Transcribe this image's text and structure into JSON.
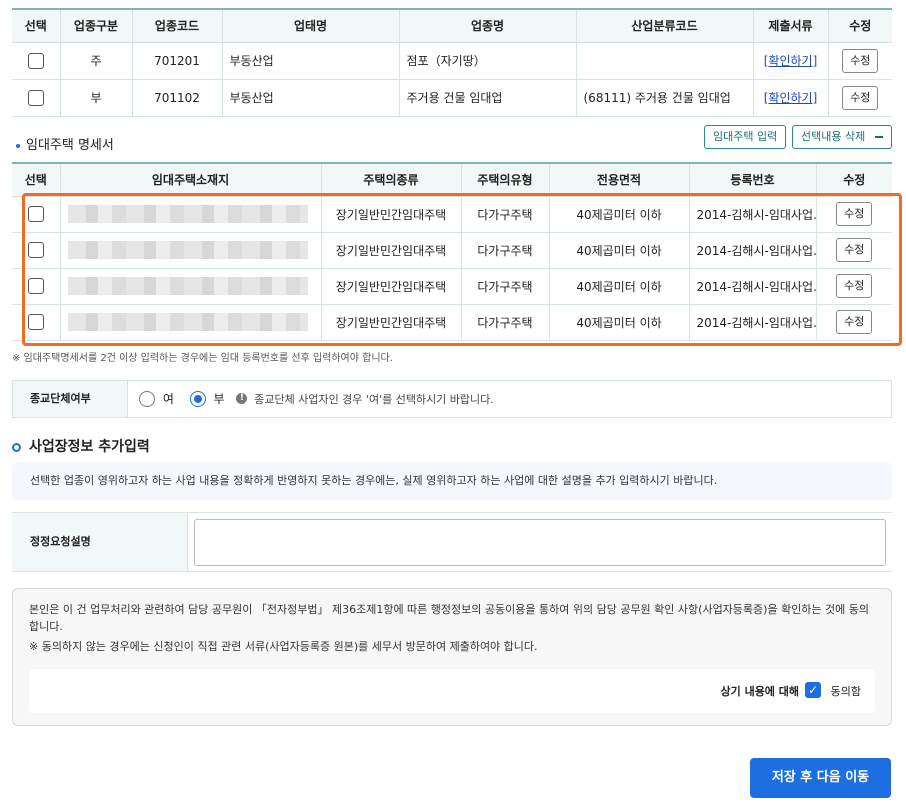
{
  "industry_table": {
    "headers": [
      "선택",
      "업종구분",
      "업종코드",
      "업태명",
      "업종명",
      "산업분류코드",
      "제출서류",
      "수정"
    ],
    "rows": [
      {
        "type": "주",
        "code": "701201",
        "business": "부동산업",
        "item": "점포（자기땅）",
        "class_code": "",
        "doc_link": "[확인하기]",
        "edit": "수정"
      },
      {
        "type": "부",
        "code": "701102",
        "business": "부동산업",
        "item": "주거용 건물 임대업",
        "class_code": "(68111) 주거용 건물 임대업",
        "doc_link": "[확인하기]",
        "edit": "수정"
      }
    ]
  },
  "rental_section": {
    "title": "임대주택 명세서",
    "input_button": "임대주택 입력",
    "delete_button": "선택내용 삭제",
    "delete_icon": "minus-icon"
  },
  "rental_table": {
    "headers": [
      "선택",
      "임대주택소재지",
      "주택의종류",
      "주택의유형",
      "전용면적",
      "등록번호",
      "수정"
    ],
    "rows": [
      {
        "kind": "장기일반민간임대주택",
        "housing_type": "다가구주택",
        "area": "40제곱미터 이하",
        "reg_no": "2014-김해시-임대사업…",
        "edit": "수정"
      },
      {
        "kind": "장기일반민간임대주택",
        "housing_type": "다가구주택",
        "area": "40제곱미터 이하",
        "reg_no": "2014-김해시-임대사업…",
        "edit": "수정"
      },
      {
        "kind": "장기일반민간임대주택",
        "housing_type": "다가구주택",
        "area": "40제곱미터 이하",
        "reg_no": "2014-김해시-임대사업…",
        "edit": "수정"
      },
      {
        "kind": "장기일반민간임대주택",
        "housing_type": "다가구주택",
        "area": "40제곱미터 이하",
        "reg_no": "2014-김해시-임대사업…",
        "edit": "수정"
      }
    ]
  },
  "note": "※ 임대주택명세서를 2건 이상 입력하는 경우에는 임대 등록번호를 선후 입력하여야 합니다.",
  "religious": {
    "label": "종교단체여부",
    "opt_yes": "여",
    "opt_no": "부",
    "selected": "부",
    "hint": "종교단체 사업자인 경우 '여'를 선택하시기 바랍니다."
  },
  "extra": {
    "title": "사업장정보 추가입력",
    "info": "선택한 업종이 영위하고자 하는 사업 내용을 정확하게 반영하지 못하는 경우에는, 실제 영위하고자 하는 사업에 대한 설명을 추가 입력하시기 바랍니다.",
    "correction_label": "정정요청설명",
    "correction_value": ""
  },
  "consent": {
    "line1": "본인은 이 건 업무처리와 관련하여 담당 공무원이 「전자정부법」 제36조제1항에 따른 행정정보의 공동이용을 통하여 위의 담당 공무원 확인 사항(사업자등록증)을 확인하는 것에 동의합니다.",
    "line2": "※  동의하지 않는 경우에는 신청인이 직접 관련 서류(사업자등록증 원본)를 세무서 방문하여 제출하여야 합니다.",
    "agree_label": "상기 내용에 대해",
    "agree_text": "동의함",
    "checked": true
  },
  "actions": {
    "save_next": "저장 후 다음 이동"
  },
  "colors": {
    "accent": "#1d6fe0",
    "highlight": "#f26b22",
    "teal": "#2a8b8b"
  }
}
